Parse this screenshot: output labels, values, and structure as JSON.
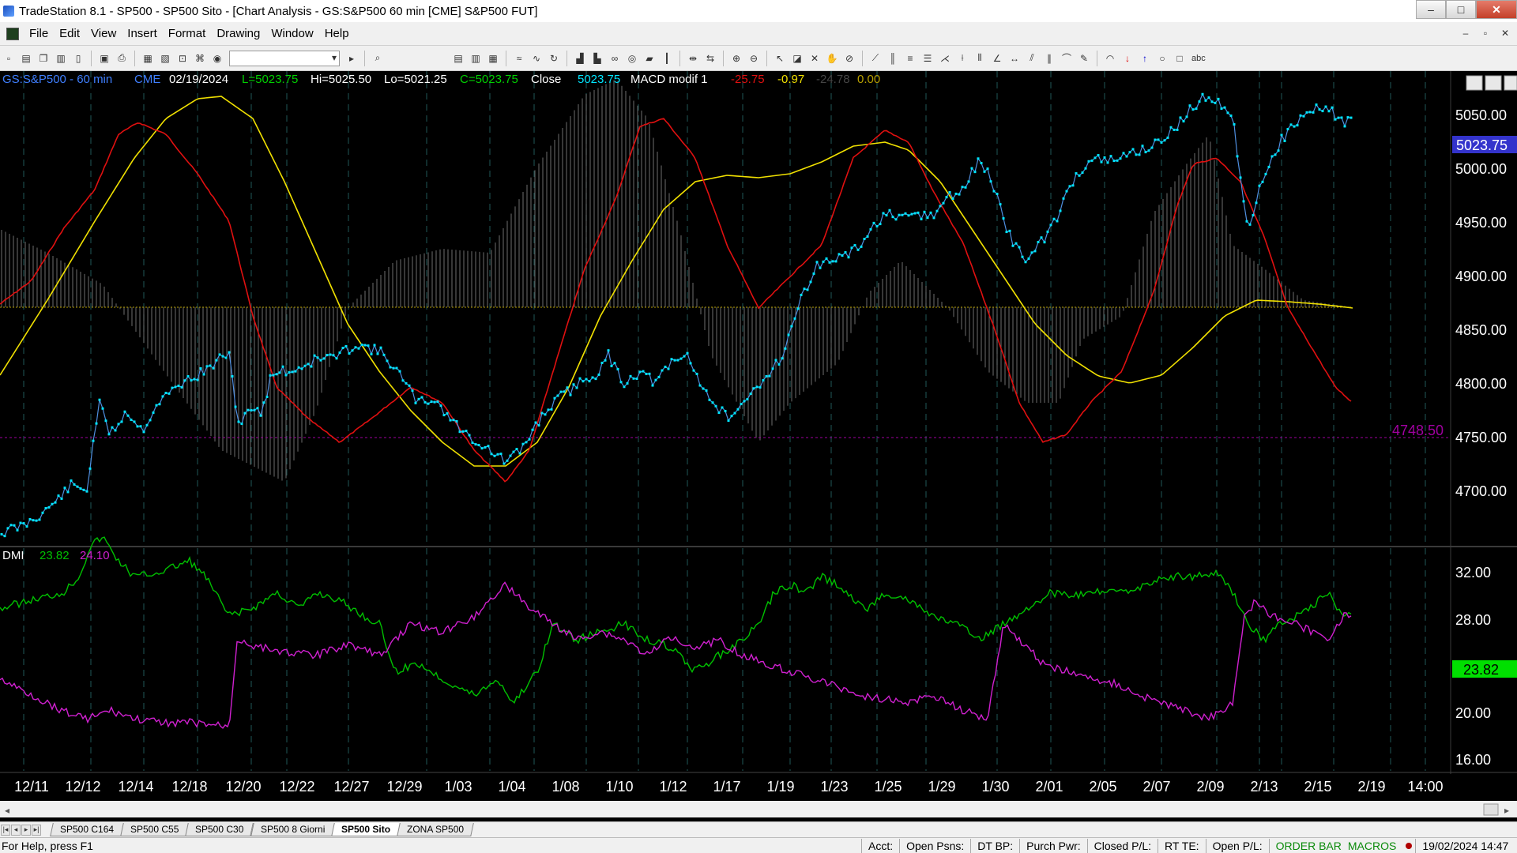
{
  "window": {
    "title": "TradeStation 8.1 - SP500 - SP500 Sito - [Chart Analysis - GS:S&P500  60 min  [CME] S&P500 FUT]",
    "minimize": "–",
    "maximize": "□",
    "close": "✕"
  },
  "menu": {
    "items": [
      "File",
      "Edit",
      "View",
      "Insert",
      "Format",
      "Drawing",
      "Window",
      "Help"
    ],
    "mdi_min": "–",
    "mdi_restore": "▫",
    "mdi_close": "✕"
  },
  "toolbar": {
    "combo_value": "",
    "text_tool": "abc"
  },
  "chart": {
    "header": {
      "symbol": "GS:S&P500 - 60 min",
      "exchange": "CME",
      "date": "02/19/2024",
      "last": "L=5023.75",
      "high": "Hi=5025.50",
      "low": "Lo=5021.25",
      "close_val": "C=5023.75",
      "close_label": "Close",
      "close_price": "5023.75",
      "indicator": "MACD modif 1",
      "macd1": "-25.75",
      "macd2": "-0.97",
      "macd3": "-24.78",
      "macd4": "0.00"
    },
    "price_axis": [
      "5050.00",
      "5000.00",
      "4950.00",
      "4900.00",
      "4850.00",
      "4800.00",
      "4750.00",
      "4700.00"
    ],
    "last_price_tag": "5023.75",
    "level_line_label": "4748.50",
    "dmi": {
      "label": "DMI",
      "plus": "23.82",
      "minus": "24.10",
      "axis": [
        "32.00",
        "28.00",
        "20.00",
        "16.00"
      ],
      "last_tag": "23.82"
    },
    "date_axis": [
      "12/11",
      "12/12",
      "12/14",
      "12/18",
      "12/20",
      "12/22",
      "12/27",
      "12/29",
      "1/03",
      "1/04",
      "1/08",
      "1/10",
      "1/12",
      "1/17",
      "1/19",
      "1/23",
      "1/25",
      "1/29",
      "1/30",
      "2/01",
      "2/05",
      "2/07",
      "2/09",
      "2/13",
      "2/15",
      "2/19",
      "14:00"
    ],
    "colors": {
      "price": "#00e5ff",
      "macd_red": "#e01010",
      "macd_yellow": "#f0e000",
      "dmi_plus": "#00c000",
      "dmi_minus": "#d020d0",
      "histogram": "#7a7a7a"
    }
  },
  "tabs": [
    "SP500 C164",
    "SP500 C55",
    "SP500 C30",
    "SP500 8 Giorni",
    "SP500 Sito",
    "ZONA SP500"
  ],
  "active_tab": "SP500 Sito",
  "status": {
    "help": "For Help, press F1",
    "acct": "Acct:",
    "open_psns": "Open Psns:",
    "dt_bp": "DT BP:",
    "purch_pwr": "Purch Pwr:",
    "closed_pl": "Closed P/L:",
    "rt_te": "RT TE:",
    "open_pl": "Open P/L:",
    "order_bar": "ORDER BAR",
    "macros": "MACROS",
    "datetime": "19/02/2024 14:47"
  }
}
